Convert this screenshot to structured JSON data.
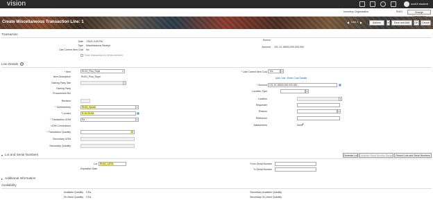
{
  "header": {
    "logo": "vision",
    "user": "scott3 student"
  },
  "org": {
    "label": "Inventory Organization",
    "value": "RU01",
    "change_button": "Change Organization"
  },
  "page": {
    "title": "Create Miscellaneous Transaction Line: 1",
    "line": "Line",
    "line_num": "1",
    "actions": "Actions",
    "add_line": "Save and Add Another Line",
    "ok": "OK",
    "cancel": "Cancel"
  },
  "transaction": {
    "section": "Transaction",
    "date_label": "Date",
    "date_value": "7/5/21 4:26 PM",
    "type_label": "Type",
    "type_value": "Miscellaneous Receipt",
    "use_cost_label": "Use Current Item Cost",
    "use_cost_value": "No",
    "enter_serials": "Enter transaction by serial numbers",
    "source_label": "Source",
    "account_label": "Account",
    "account_value": "101-10-18600-000-000-000"
  },
  "line_details": {
    "section": "Line Details",
    "item_label": "Item",
    "item_value": "RU01_Plus_Rupe",
    "desc_label": "Item Description",
    "desc_value": "RU01_Plus_Rupe",
    "owning_site_label": "Owning Party Site",
    "owning_party_label": "Owning Party",
    "procurement_label": "Procurement BU",
    "revision_label": "Revision",
    "subinv_label": "Subinventory",
    "subinv_value": "RU01_Spradi",
    "locator_label": "Locator",
    "locator_value": "R-10-S4-B4",
    "uom_label": "Transaction UOM",
    "uom_value": "Ea",
    "uom_conv_label": "UOM Conversions",
    "qty_label": "Transaction Quantity",
    "qty_value": "10",
    "sec_uom_label": "Secondary UOM",
    "sec_qty_label": "Secondary Quantity",
    "use_cost2_label": "Use Current Item Cost",
    "use_cost2_value": "Yes",
    "add_cost": "Add Cost",
    "enter_cost": "Enter Cost Details",
    "account2_label": "Account",
    "account2_value": "101-10-18600-000-000-000",
    "location_type_label": "Location Type",
    "location_label": "Location",
    "requester_label": "Requester",
    "reason_label": "Reason",
    "reference_label": "Reference",
    "attachments_label": "Attachments",
    "attachments_value": "None"
  },
  "lots": {
    "section": "Lot and Serial Numbers",
    "generate_lot": "Generate Lot",
    "generate_serial": "Generate Serial Number Range",
    "record": "Record Lots and Serial Numbers",
    "lot_label": "Lot",
    "lot_value": "RU01_LAT01",
    "exp_label": "Expiration Date",
    "from_serial_label": "From Serial Number",
    "to_serial_label": "To Serial Number"
  },
  "additional": {
    "section": "Additional Information"
  },
  "availability": {
    "section": "Availability",
    "avail_qty_label": "Available Quantity",
    "avail_qty_value": "0 Ea",
    "onhand_label": "On-Hand Quantity",
    "onhand_value": "0 Ea",
    "sec_avail_label": "Secondary Available Quantity",
    "sec_onhand_label": "Secondary On-Hand Quantity"
  }
}
